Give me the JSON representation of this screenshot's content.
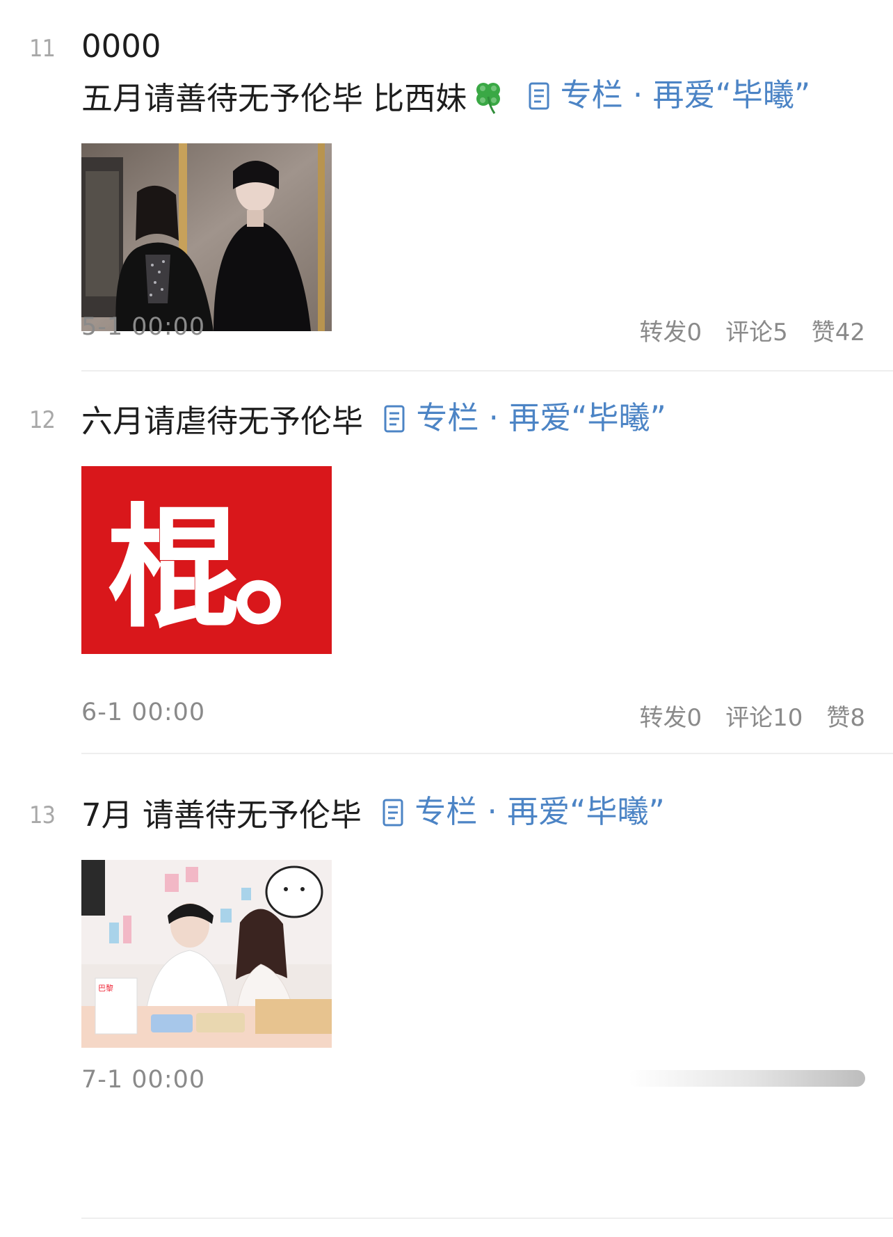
{
  "posts": [
    {
      "index": "11",
      "title_line1": "0000",
      "title_line2": "五月请善待无予伦毕 比西妹",
      "has_clover": true,
      "column_label": "专栏 · 再爱“毕曦”",
      "date": "5-1 00:00",
      "stats": {
        "repost": "转发0",
        "comment": "评论5",
        "like": "赞42"
      },
      "image": "photo-couple-dark-gallery"
    },
    {
      "index": "12",
      "title_line1": "六月请虐待无予伦毕",
      "column_label": "专栏 · 再爱“毕曦”",
      "image_text": "棍。",
      "date": "6-1 00:00",
      "stats": {
        "repost": "转发0",
        "comment": "评论10",
        "like": "赞8"
      },
      "image": "red-square-graphic"
    },
    {
      "index": "13",
      "title_line1": "7月 请善待无予伦毕",
      "column_label": "专栏 · 再爱“毕曦”",
      "image_text": "巴黎",
      "date": "7-1 00:00",
      "image": "photo-couple-livestream"
    }
  ],
  "colors": {
    "link": "#4c84c5",
    "meta": "#8a8a8a",
    "index": "#a8a8a8",
    "red_bg": "#d9171b"
  }
}
